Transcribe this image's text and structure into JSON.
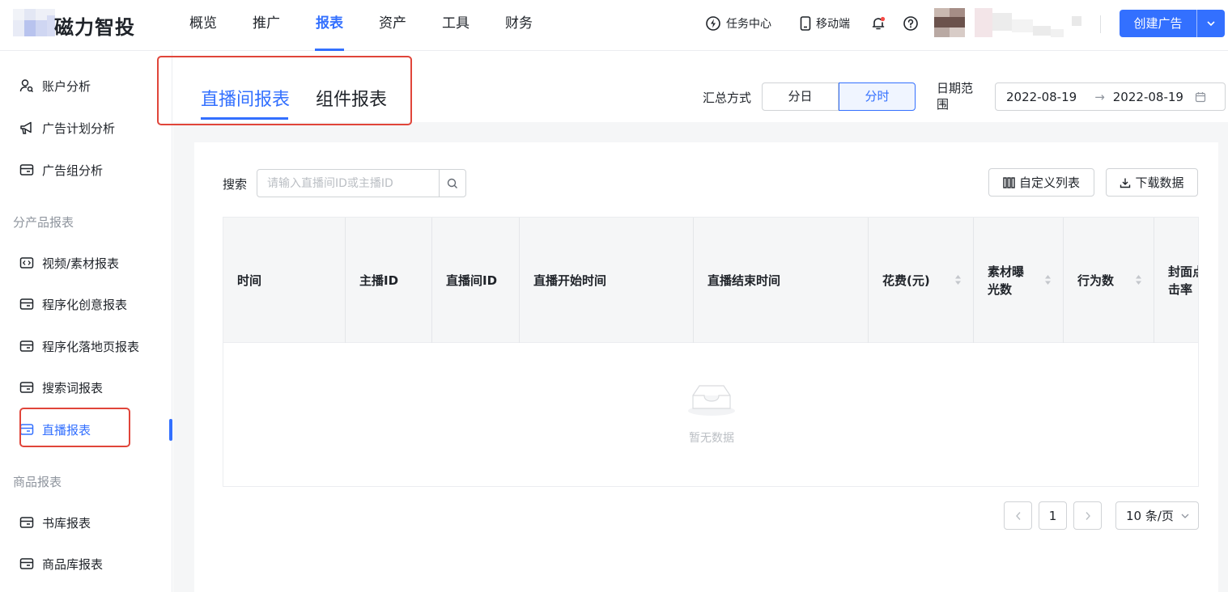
{
  "brand": {
    "name": "磁力智投"
  },
  "nav": {
    "items": [
      {
        "label": "概览",
        "active": false
      },
      {
        "label": "推广",
        "active": false
      },
      {
        "label": "报表",
        "active": true
      },
      {
        "label": "资产",
        "active": false
      },
      {
        "label": "工具",
        "active": false
      },
      {
        "label": "财务",
        "active": false
      }
    ]
  },
  "header_tools": {
    "task_center": "任务中心",
    "mobile": "移动端",
    "create_ad": "创建广告"
  },
  "sidebar": {
    "items": [
      {
        "label": "账户分析",
        "icon": "user-search-icon"
      },
      {
        "label": "广告计划分析",
        "icon": "megaphone-icon"
      },
      {
        "label": "广告组分析",
        "icon": "folder-icon"
      }
    ],
    "group_product": "分产品报表",
    "product_items": [
      {
        "label": "视频/素材报表",
        "icon": "video-icon"
      },
      {
        "label": "程序化创意报表",
        "icon": "folder-icon"
      },
      {
        "label": "程序化落地页报表",
        "icon": "folder-icon"
      },
      {
        "label": "搜索词报表",
        "icon": "folder-icon"
      },
      {
        "label": "直播报表",
        "icon": "folder-icon",
        "active": true
      }
    ],
    "group_goods": "商品报表",
    "goods_items": [
      {
        "label": "书库报表",
        "icon": "folder-icon"
      },
      {
        "label": "商品库报表",
        "icon": "folder-icon"
      }
    ]
  },
  "tabs": [
    {
      "label": "直播间报表",
      "active": true
    },
    {
      "label": "组件报表",
      "active": false
    }
  ],
  "controls": {
    "summary_label": "汇总方式",
    "segments": [
      {
        "label": "分日",
        "active": false
      },
      {
        "label": "分时",
        "active": true
      }
    ],
    "date_label": "日期范围",
    "date_start": "2022-08-19",
    "date_sep": "→",
    "date_end": "2022-08-19"
  },
  "toolbar": {
    "search_label": "搜索",
    "search_placeholder": "请输入直播间ID或主播ID",
    "custom_columns": "自定义列表",
    "download": "下载数据"
  },
  "table": {
    "columns": [
      {
        "label": "时间",
        "sortable": false
      },
      {
        "label": "主播ID",
        "sortable": false
      },
      {
        "label": "直播间ID",
        "sortable": false
      },
      {
        "label": "直播开始时间",
        "sortable": false
      },
      {
        "label": "直播结束时间",
        "sortable": false
      },
      {
        "label": "花费(元)",
        "sortable": true
      },
      {
        "label": "素材曝光数",
        "sortable": true
      },
      {
        "label": "行为数",
        "sortable": true
      },
      {
        "label": "封面点击率",
        "sortable": false
      }
    ],
    "empty_text": "暂无数据"
  },
  "pagination": {
    "current_page": "1",
    "page_size": "10 条/页"
  },
  "colors": {
    "accent": "#3370ff",
    "annotation": "#e0453a"
  }
}
